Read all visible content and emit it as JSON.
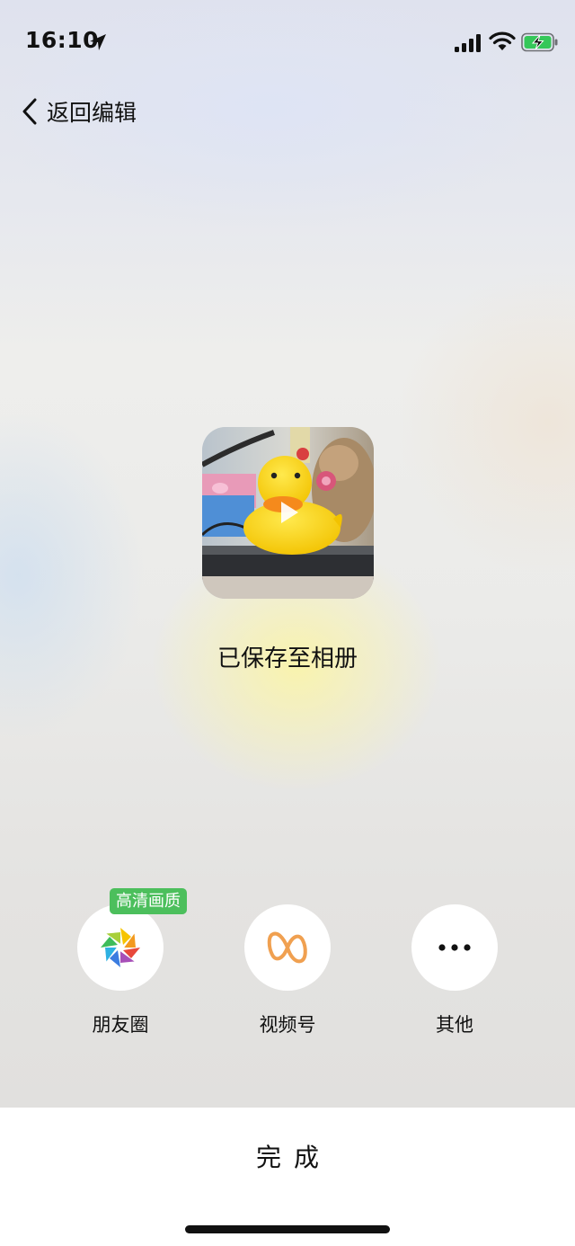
{
  "status_bar": {
    "time": "16:10",
    "icons": [
      "location-arrow-icon",
      "cellular-signal-icon",
      "wifi-icon",
      "battery-charging-icon"
    ],
    "battery_color": "#35c759"
  },
  "nav": {
    "back_label": "返回编辑",
    "back_icon": "chevron-left-icon"
  },
  "preview": {
    "thumbnail_icon": "video-thumbnail",
    "play_icon": "play-icon",
    "saved_message": "已保存至相册"
  },
  "share": {
    "items": [
      {
        "label": "朋友圈",
        "icon": "moments-aperture-icon",
        "badge": "高清画质"
      },
      {
        "label": "视频号",
        "icon": "channels-icon"
      },
      {
        "label": "其他",
        "icon": "more-dots-icon"
      }
    ],
    "badge_color": "#4cbf5c",
    "channels_color": "#f0a050"
  },
  "footer": {
    "done_label": "完成"
  }
}
